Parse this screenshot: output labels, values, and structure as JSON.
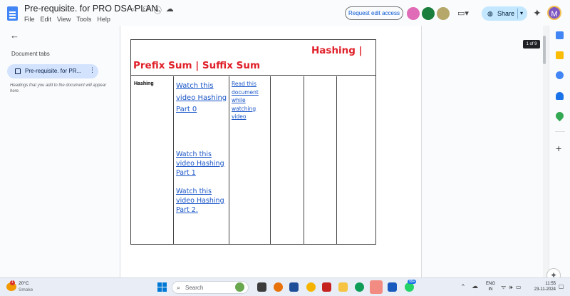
{
  "app": {
    "title": "Pre-requisite. for PRO DSA PLAN.",
    "menu": [
      "File",
      "Edit",
      "View",
      "Tools",
      "Help"
    ],
    "request_edit_label": "Request edit access",
    "share_label": "Share",
    "account_initial": "M"
  },
  "left_panel": {
    "heading": "Document tabs",
    "tab_label": "Pre-requisite. for PR...",
    "hint": "Headings that you add to the document will appear here."
  },
  "document": {
    "heading_line1": "Hashing |",
    "heading_line2": "Prefix Sum | Suffix Sum",
    "topic": "Hashing",
    "links": {
      "video_part0": "Watch this video Hashing Part 0",
      "video_part1": "Watch this video Hashing Part 1",
      "video_part2": "Watch this video Hashing Part 2.",
      "read_doc": "Read this document while watching video"
    },
    "page_count": "1 of 9"
  },
  "taskbar": {
    "weather_badge": "1",
    "temperature": "20°C",
    "weather_desc": "Smoke",
    "search_placeholder": "Search",
    "language_top": "ENG",
    "language_bottom": "IN",
    "time": "11:55",
    "date": "23-11-2024",
    "badge_count": "99+"
  },
  "colors": {
    "heading_red": "#e0202a",
    "link_blue": "#1a56c8",
    "share_bg": "#c2e7ff",
    "tab_active_bg": "#d3e3fd"
  }
}
